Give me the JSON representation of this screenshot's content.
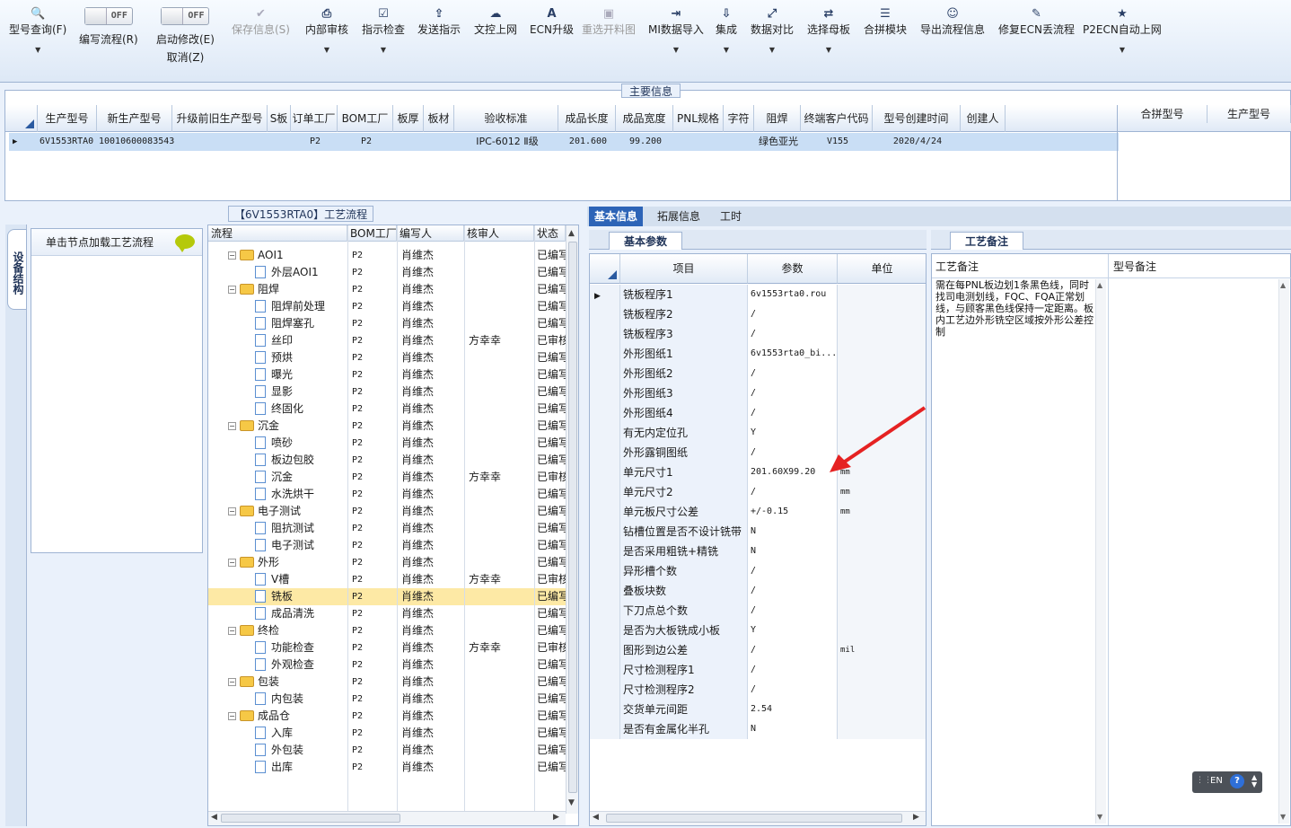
{
  "toolbar": {
    "items": [
      {
        "label": "型号查询(F)",
        "icon": "search-icon",
        "glyph": "🔍"
      },
      {
        "label": "编写流程(R)",
        "type": "toggle",
        "state": "OFF"
      },
      {
        "label": "启动修改(E)",
        "sub": "取消(Z)",
        "type": "toggle",
        "state": "OFF"
      },
      {
        "label": "保存信息(S)",
        "icon": "check-icon",
        "glyph": "✔",
        "disabled": true
      },
      {
        "label": "内部审核",
        "icon": "printer-icon",
        "glyph": "⎙"
      },
      {
        "label": "指示检查",
        "icon": "checkbox-icon",
        "glyph": "☑"
      },
      {
        "label": "发送指示",
        "icon": "upload-icon",
        "glyph": "⇪"
      },
      {
        "label": "文控上网",
        "icon": "cloud-upload-icon",
        "glyph": "☁"
      },
      {
        "label": "ECN升级",
        "icon": "ecn-icon",
        "glyph": "A"
      },
      {
        "label": "重选开料图",
        "icon": "image-icon",
        "glyph": "▣",
        "disabled": true
      },
      {
        "label": "MI数据导入",
        "icon": "import-icon",
        "glyph": "⇥"
      },
      {
        "label": "集成",
        "icon": "download-icon",
        "glyph": "⇩"
      },
      {
        "label": "数据对比",
        "icon": "compare-icon",
        "glyph": "⤢"
      },
      {
        "label": "选择母板",
        "icon": "shuffle-icon",
        "glyph": "⇄"
      },
      {
        "label": "合拼模块",
        "icon": "list-icon",
        "glyph": "☰"
      },
      {
        "label": "导出流程信息",
        "icon": "smiley-icon",
        "glyph": "☺"
      },
      {
        "label": "修复ECN丢流程",
        "icon": "wrench-icon",
        "glyph": "✎"
      },
      {
        "label": "P2ECN自动上网",
        "icon": "star-icon",
        "glyph": "★"
      }
    ]
  },
  "main_info": {
    "title": "主要信息",
    "columns": [
      "生产型号",
      "新生产型号",
      "升级前旧生产型号",
      "S板",
      "订单工厂",
      "BOM工厂",
      "板厚",
      "板材",
      "验收标准",
      "成品长度",
      "成品宽度",
      "PNL规格",
      "字符",
      "阻焊",
      "终端客户代码",
      "型号创建时间",
      "创建人"
    ],
    "row": [
      "6V1553RTA0",
      "10010600083543",
      "",
      "",
      "P2",
      "P2",
      "",
      "",
      "IPC-6012 Ⅱ级",
      "201.600",
      "99.200",
      "",
      "",
      "绿色亚光",
      "V155",
      "2020/4/24",
      ""
    ],
    "side_columns": [
      "合拼型号",
      "生产型号"
    ]
  },
  "left_panel": {
    "vertical_tab": "设备结构",
    "header": "单击节点加载工艺流程"
  },
  "tree": {
    "title": "【6V1553RTA0】工艺流程",
    "columns": [
      "流程",
      "BOM工厂",
      "编写人",
      "核审人",
      "状态"
    ],
    "rows": [
      {
        "level": 1,
        "name": "AOI1",
        "bom": "P2",
        "writer": "肖维杰",
        "reviewer": "",
        "status": "已编写"
      },
      {
        "level": 2,
        "name": "外层AOI1",
        "bom": "P2",
        "writer": "肖维杰",
        "reviewer": "",
        "status": "已编写"
      },
      {
        "level": 1,
        "name": "阻焊",
        "bom": "P2",
        "writer": "肖维杰",
        "reviewer": "",
        "status": "已编写"
      },
      {
        "level": 2,
        "name": "阻焊前处理",
        "bom": "P2",
        "writer": "肖维杰",
        "reviewer": "",
        "status": "已编写"
      },
      {
        "level": 2,
        "name": "阻焊塞孔",
        "bom": "P2",
        "writer": "肖维杰",
        "reviewer": "",
        "status": "已编写"
      },
      {
        "level": 2,
        "name": "丝印",
        "bom": "P2",
        "writer": "肖维杰",
        "reviewer": "方幸幸",
        "status": "已审核"
      },
      {
        "level": 2,
        "name": "预烘",
        "bom": "P2",
        "writer": "肖维杰",
        "reviewer": "",
        "status": "已编写"
      },
      {
        "level": 2,
        "name": "曝光",
        "bom": "P2",
        "writer": "肖维杰",
        "reviewer": "",
        "status": "已编写"
      },
      {
        "level": 2,
        "name": "显影",
        "bom": "P2",
        "writer": "肖维杰",
        "reviewer": "",
        "status": "已编写"
      },
      {
        "level": 2,
        "name": "终固化",
        "bom": "P2",
        "writer": "肖维杰",
        "reviewer": "",
        "status": "已编写"
      },
      {
        "level": 1,
        "name": "沉金",
        "bom": "P2",
        "writer": "肖维杰",
        "reviewer": "",
        "status": "已编写"
      },
      {
        "level": 2,
        "name": "喷砂",
        "bom": "P2",
        "writer": "肖维杰",
        "reviewer": "",
        "status": "已编写"
      },
      {
        "level": 2,
        "name": "板边包胶",
        "bom": "P2",
        "writer": "肖维杰",
        "reviewer": "",
        "status": "已编写"
      },
      {
        "level": 2,
        "name": "沉金",
        "bom": "P2",
        "writer": "肖维杰",
        "reviewer": "方幸幸",
        "status": "已审核"
      },
      {
        "level": 2,
        "name": "水洗烘干",
        "bom": "P2",
        "writer": "肖维杰",
        "reviewer": "",
        "status": "已编写"
      },
      {
        "level": 1,
        "name": "电子测试",
        "bom": "P2",
        "writer": "肖维杰",
        "reviewer": "",
        "status": "已编写"
      },
      {
        "level": 2,
        "name": "阻抗测试",
        "bom": "P2",
        "writer": "肖维杰",
        "reviewer": "",
        "status": "已编写"
      },
      {
        "level": 2,
        "name": "电子测试",
        "bom": "P2",
        "writer": "肖维杰",
        "reviewer": "",
        "status": "已编写"
      },
      {
        "level": 1,
        "name": "外形",
        "bom": "P2",
        "writer": "肖维杰",
        "reviewer": "",
        "status": "已编写"
      },
      {
        "level": 2,
        "name": "V槽",
        "bom": "P2",
        "writer": "肖维杰",
        "reviewer": "方幸幸",
        "status": "已审核"
      },
      {
        "level": 2,
        "name": "铣板",
        "bom": "P2",
        "writer": "肖维杰",
        "reviewer": "",
        "status": "已编写",
        "selected": true
      },
      {
        "level": 2,
        "name": "成品清洗",
        "bom": "P2",
        "writer": "肖维杰",
        "reviewer": "",
        "status": "已编写"
      },
      {
        "level": 1,
        "name": "终检",
        "bom": "P2",
        "writer": "肖维杰",
        "reviewer": "",
        "status": "已编写"
      },
      {
        "level": 2,
        "name": "功能检查",
        "bom": "P2",
        "writer": "肖维杰",
        "reviewer": "方幸幸",
        "status": "已审核"
      },
      {
        "level": 2,
        "name": "外观检查",
        "bom": "P2",
        "writer": "肖维杰",
        "reviewer": "",
        "status": "已编写"
      },
      {
        "level": 1,
        "name": "包装",
        "bom": "P2",
        "writer": "肖维杰",
        "reviewer": "",
        "status": "已编写"
      },
      {
        "level": 2,
        "name": "内包装",
        "bom": "P2",
        "writer": "肖维杰",
        "reviewer": "",
        "status": "已编写"
      },
      {
        "level": 1,
        "name": "成品仓",
        "bom": "P2",
        "writer": "肖维杰",
        "reviewer": "",
        "status": "已编写"
      },
      {
        "level": 2,
        "name": "入库",
        "bom": "P2",
        "writer": "肖维杰",
        "reviewer": "",
        "status": "已编写"
      },
      {
        "level": 2,
        "name": "外包装",
        "bom": "P2",
        "writer": "肖维杰",
        "reviewer": "",
        "status": "已编写"
      },
      {
        "level": 2,
        "name": "出库",
        "bom": "P2",
        "writer": "肖维杰",
        "reviewer": "",
        "status": "已编写"
      }
    ]
  },
  "right": {
    "tabs": [
      "基本信息",
      "拓展信息",
      "工时"
    ],
    "sub_tab": "基本参数",
    "notes_tab": "工艺备注",
    "param_columns": [
      "项目",
      "参数",
      "单位"
    ],
    "params": [
      {
        "k": "铣板程序1",
        "v": "6v1553rta0.rou",
        "u": ""
      },
      {
        "k": "铣板程序2",
        "v": "/",
        "u": ""
      },
      {
        "k": "铣板程序3",
        "v": "/",
        "u": ""
      },
      {
        "k": "外形图纸1",
        "v": "6v1553rta0_bi...",
        "u": ""
      },
      {
        "k": "外形图纸2",
        "v": "/",
        "u": ""
      },
      {
        "k": "外形图纸3",
        "v": "/",
        "u": ""
      },
      {
        "k": "外形图纸4",
        "v": "/",
        "u": ""
      },
      {
        "k": "有无内定位孔",
        "v": "Y",
        "u": ""
      },
      {
        "k": "外形露铜图纸",
        "v": "/",
        "u": ""
      },
      {
        "k": "单元尺寸1",
        "v": "201.60X99.20",
        "u": "mm"
      },
      {
        "k": "单元尺寸2",
        "v": "/",
        "u": "mm"
      },
      {
        "k": "单元板尺寸公差",
        "v": "+/-0.15",
        "u": "mm"
      },
      {
        "k": "钻槽位置是否不设计铣带",
        "v": "N",
        "u": ""
      },
      {
        "k": "是否采用粗铣+精铣",
        "v": "N",
        "u": ""
      },
      {
        "k": "异形槽个数",
        "v": "/",
        "u": ""
      },
      {
        "k": "叠板块数",
        "v": "/",
        "u": ""
      },
      {
        "k": "下刀点总个数",
        "v": "/",
        "u": ""
      },
      {
        "k": "是否为大板铣成小板",
        "v": "Y",
        "u": ""
      },
      {
        "k": "图形到边公差",
        "v": "/",
        "u": "mil"
      },
      {
        "k": "尺寸检测程序1",
        "v": "/",
        "u": ""
      },
      {
        "k": "尺寸检测程序2",
        "v": "/",
        "u": ""
      },
      {
        "k": "交货单元间距",
        "v": "2.54",
        "u": ""
      },
      {
        "k": "是否有金属化半孔",
        "v": "N",
        "u": ""
      }
    ],
    "note_columns": [
      "工艺备注",
      "型号备注"
    ],
    "note_text": "需在每PNL板边划1条黑色线，同时找司电测划线，FQC、FQA正常划线，与顾客黑色线保持一定距离。板内工艺边外形铣空区域按外形公差控制"
  },
  "lang_bar": {
    "label": "EN",
    "help": "?"
  }
}
